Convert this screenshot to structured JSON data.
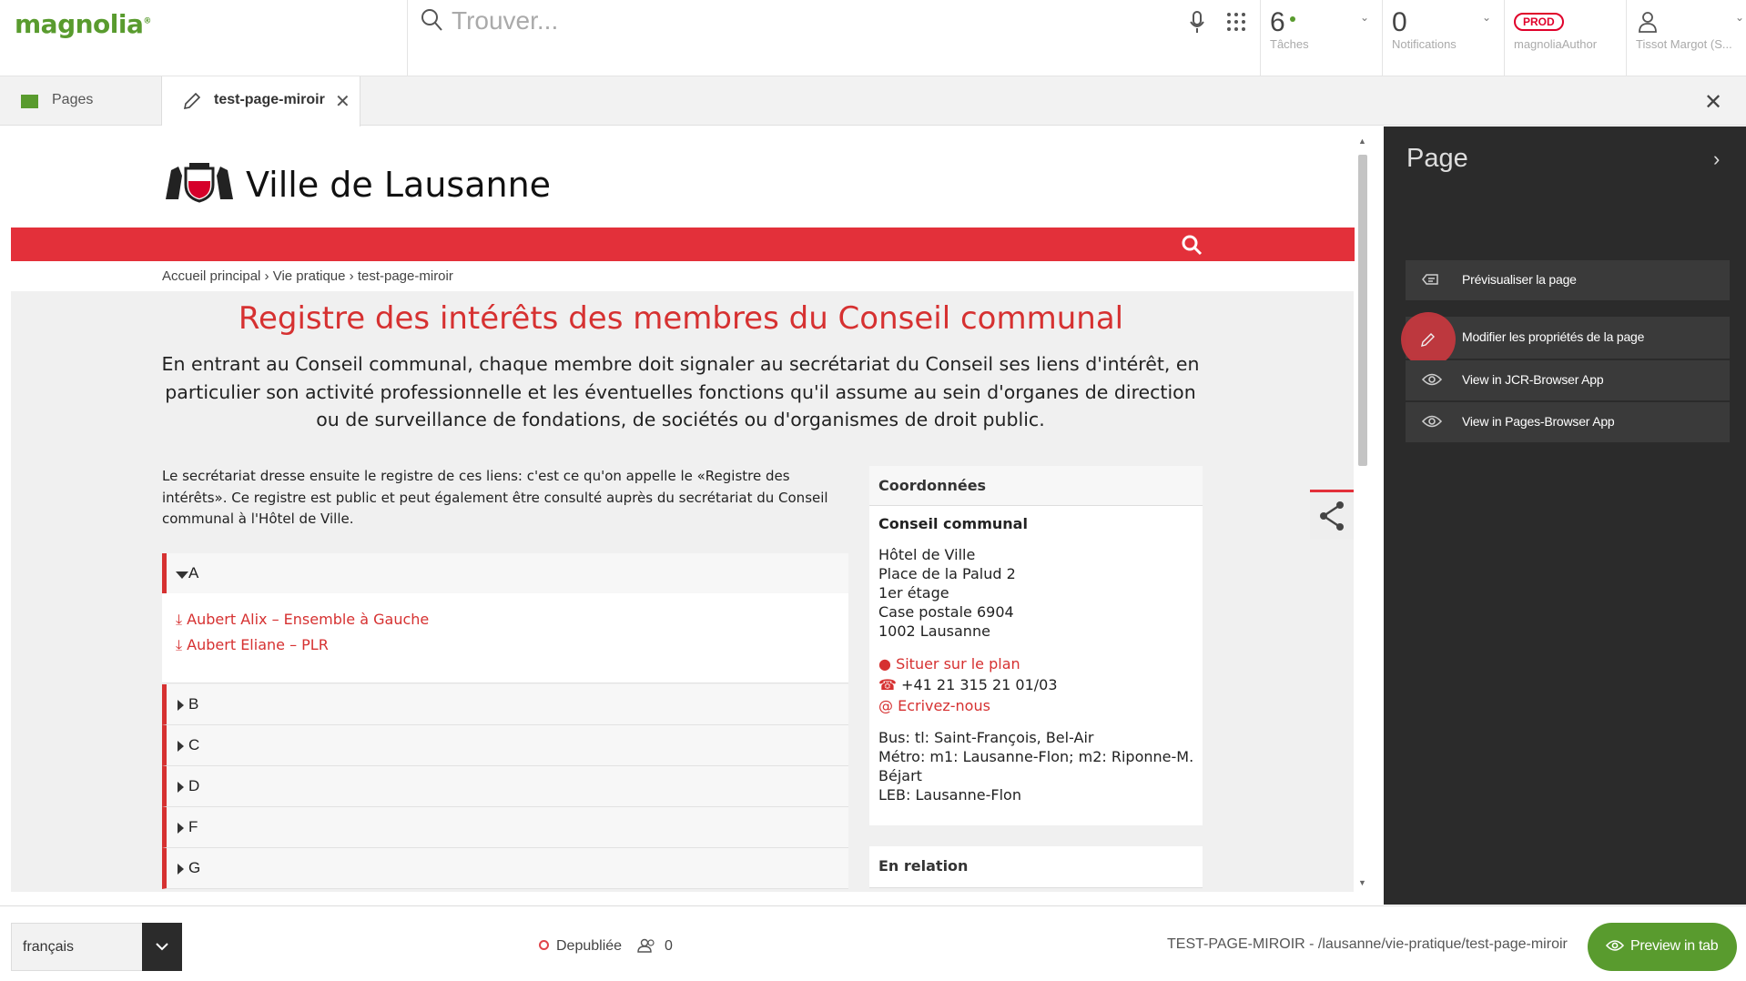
{
  "app": {
    "logo": "magnolia",
    "logo_mark": "®"
  },
  "topbar": {
    "search_placeholder": "Trouver...",
    "tasks": {
      "count": "6",
      "label": "Tâches"
    },
    "notifications": {
      "count": "0",
      "label": "Notifications"
    },
    "env": {
      "badge": "PROD",
      "label": "magnoliaAuthor"
    },
    "user": {
      "label": "Tissot Margot (S..."
    }
  },
  "tabs": [
    {
      "label": "Pages"
    },
    {
      "label": "test-page-miroir"
    }
  ],
  "page": {
    "site_title": "Ville de Lausanne",
    "breadcrumb": "Accueil principal › Vie pratique › test-page-miroir",
    "heading": "Registre des intérêts des membres du Conseil communal",
    "intro": "En entrant au Conseil communal, chaque membre doit signaler au secrétariat du Conseil ses liens d'intérêt, en particulier son activité professionnelle et les éventuelles fonctions qu'il assume au sein d'organes de direction ou de surveillance de fondations, de sociétés ou d'organismes de droit public.",
    "paragraph": "Le secrétariat dresse ensuite le registre de ces liens: c'est ce qu'on appelle le «Registre des intérêts». Ce registre est public et peut également être consulté auprès du secrétariat du Conseil communal à l'Hôtel de Ville.",
    "accordion": [
      {
        "letter": "A",
        "expanded": true,
        "items": [
          "Aubert Alix – Ensemble à Gauche",
          "Aubert Eliane – PLR"
        ]
      },
      {
        "letter": "B",
        "expanded": false
      },
      {
        "letter": "C",
        "expanded": false
      },
      {
        "letter": "D",
        "expanded": false
      },
      {
        "letter": "F",
        "expanded": false
      },
      {
        "letter": "G",
        "expanded": false
      }
    ],
    "aside": {
      "title": "Coordonnées",
      "org": "Conseil communal",
      "address": [
        "Hôtel de Ville",
        "Place de la Palud 2",
        "1er étage",
        "Case postale 6904",
        "1002 Lausanne"
      ],
      "map_link": "Situer sur le plan",
      "phone": "+41 21 315 21 01/03",
      "email_link": "Ecrivez-nous",
      "transport": [
        "Bus: tl: Saint-François, Bel-Air",
        "Métro: m1: Lausanne-Flon; m2: Riponne-M.",
        "Béjart",
        "LEB: Lausanne-Flon"
      ],
      "related_title": "En relation"
    }
  },
  "panel": {
    "title": "Page",
    "actions": [
      {
        "label": "Prévisualiser la page",
        "icon": "preview-icon"
      },
      {
        "label": "Modifier les propriétés de la page",
        "icon": "pencil-icon"
      },
      {
        "label": "View in JCR-Browser App",
        "icon": "eye-icon"
      },
      {
        "label": "View in Pages-Browser App",
        "icon": "eye-icon"
      }
    ]
  },
  "footer": {
    "language": "français",
    "status": "Depubliée",
    "users_count": "0",
    "path": "TEST-PAGE-MIROIR - /lausanne/vie-pratique/test-page-miroir",
    "preview_button": "Preview in tab"
  },
  "colors": {
    "brand_green": "#599b2e",
    "lausanne_red": "#e3303a",
    "dark_panel": "#2b2b2b"
  }
}
